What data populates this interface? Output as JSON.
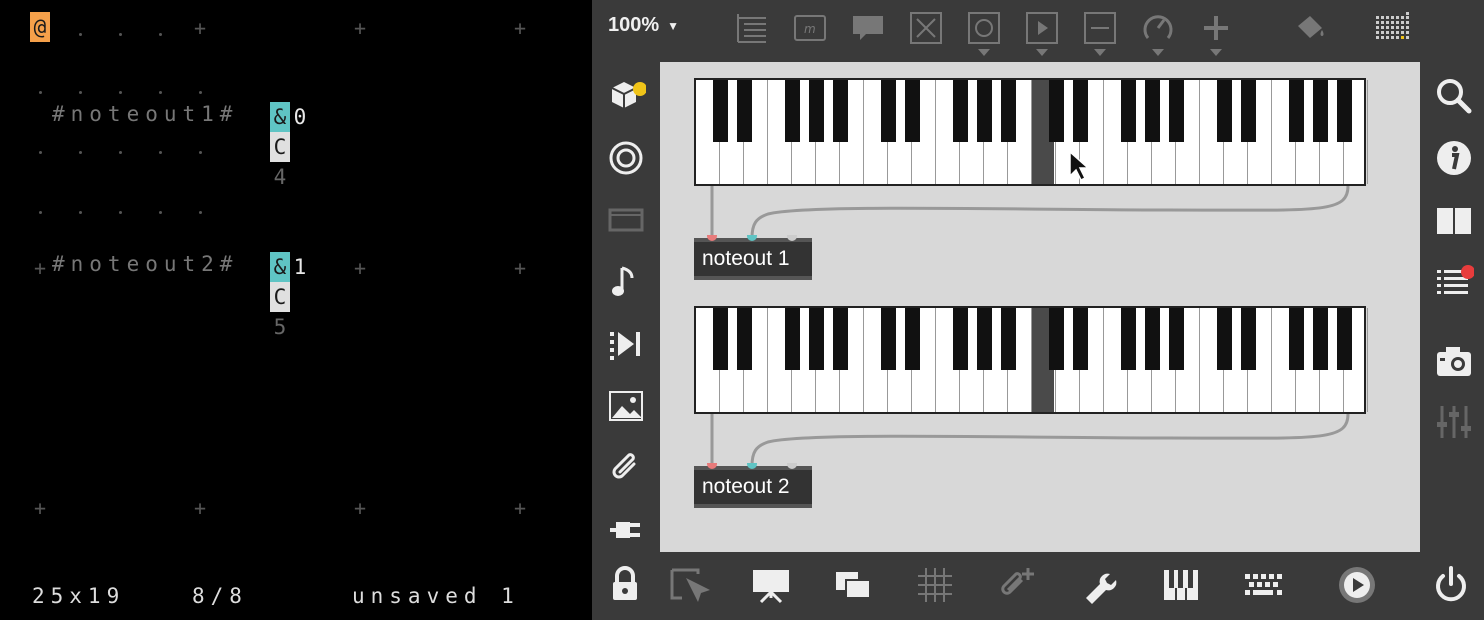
{
  "orca": {
    "cursor_char": "@",
    "op1_name": "#noteout1#",
    "op1_amp": "&",
    "op1_value": "0",
    "op1_note": "C",
    "op1_octave": "4",
    "op2_name": "#noteout2#",
    "op2_amp": "&",
    "op2_value": "1",
    "op2_note": "C",
    "op2_octave": "5",
    "status_size": "25x19",
    "status_frame": "8/8",
    "status_file": "unsaved 1"
  },
  "max": {
    "zoom_label": "100%",
    "noteout1_label": "noteout 1",
    "noteout2_label": "noteout 2"
  },
  "colors": {
    "orca_cursor": "#f5a04a",
    "orca_highlight": "#5fc4c4",
    "notification": "#f0c419",
    "alert": "#e83c3c"
  }
}
